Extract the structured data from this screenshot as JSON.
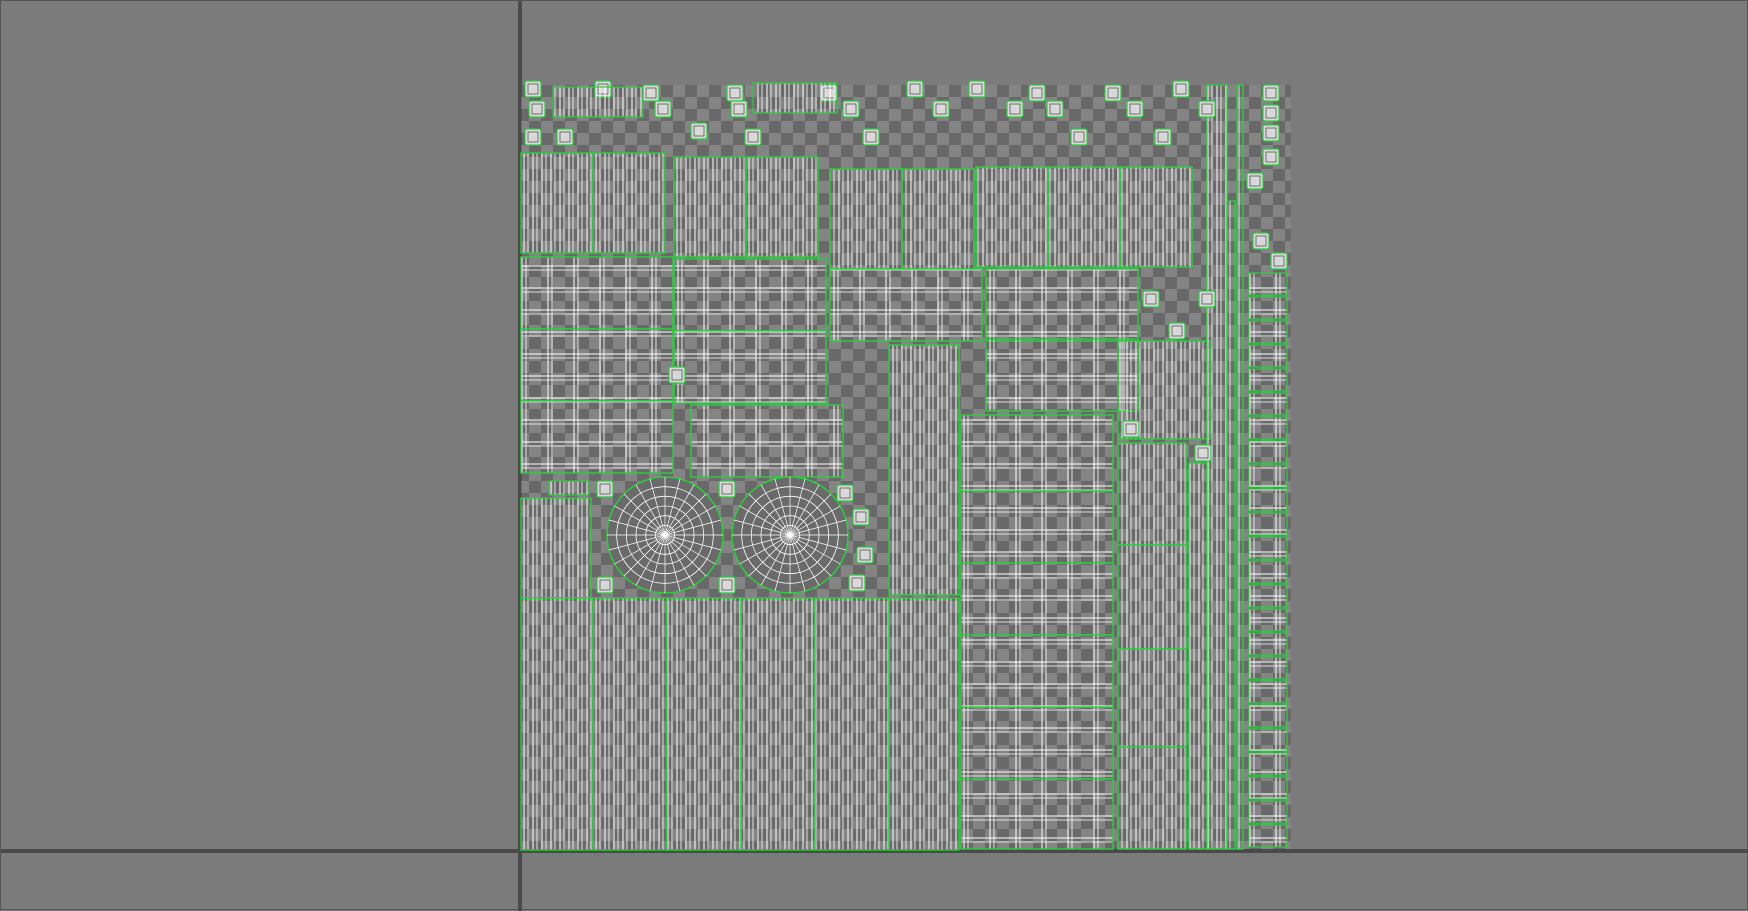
{
  "view": {
    "background_color": "#7b7b7b",
    "axis_color": "#4a4a4a",
    "wire_color": "#ffffff",
    "island_border_color": "#2ecc40",
    "checker_dark": "#5a5a5a",
    "checker_light": "#8c8c8c"
  }
}
